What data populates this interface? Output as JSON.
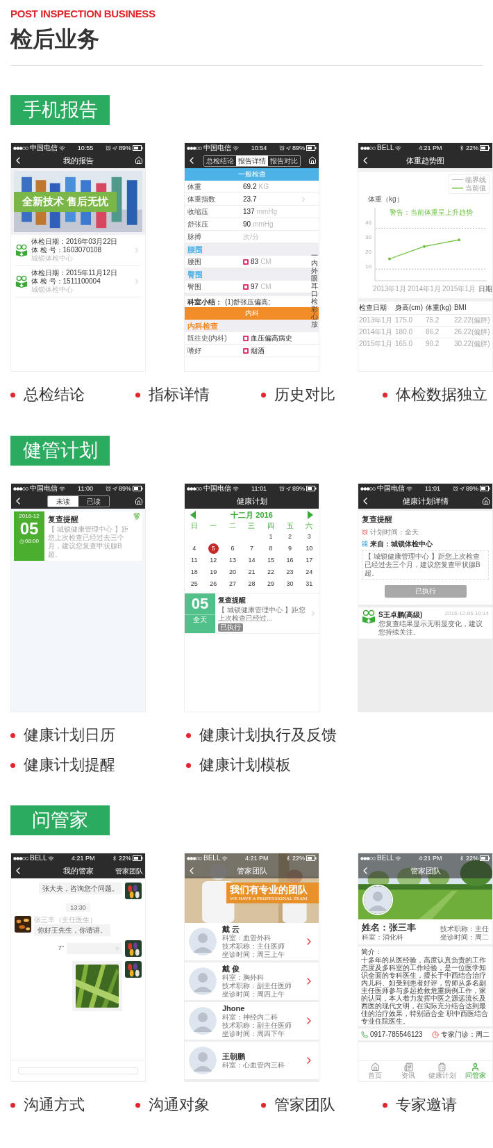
{
  "page_header": {
    "english_title": "POST INSPECTION BUSINESS",
    "title": "检后业务"
  },
  "sections": [
    {
      "tag": "手机报告",
      "screens": [
        {
          "kind": "report_list",
          "status": {
            "carrier": "中国电信",
            "time": "10:55",
            "battery": "89%",
            "bluetooth": false
          },
          "nav": {
            "title": "我的报告",
            "back": true,
            "home": true
          },
          "banner_caption": "全新技术 售后无忧",
          "reports": [
            {
              "date": "体检日期：2016年03月22日",
              "number": "体 检 号：1603070108",
              "center": "城锁体检中心"
            },
            {
              "date": "体检日期：2015年11月12日",
              "number": "体 检 号：1511100004",
              "center": "城锁体检中心"
            }
          ]
        },
        {
          "kind": "report_detail",
          "status": {
            "carrier": "中国电信",
            "time": "10:54",
            "battery": "89%",
            "bluetooth": false
          },
          "nav": {
            "back": true,
            "home": true,
            "tabs": [
              {
                "label": "总检结论",
                "selected": false
              },
              {
                "label": "报告详情",
                "selected": true
              },
              {
                "label": "报告对比",
                "selected": false
              }
            ]
          },
          "items": [
            {
              "kind": "band",
              "text": "一般检查",
              "color": "#4db3e6"
            },
            {
              "kind": "row",
              "label": "体重",
              "value": "69.2",
              "unit": "KG",
              "flagged": false,
              "more": false
            },
            {
              "kind": "row",
              "label": "体重指数",
              "value": "23.7",
              "flagged": false,
              "more": true
            },
            {
              "kind": "row",
              "label": "收缩压",
              "value": "137",
              "unit": "mmHg",
              "flagged": false,
              "more": false
            },
            {
              "kind": "row",
              "label": "舒张压",
              "value": "90",
              "unit": "mmHg",
              "flagged": false,
              "more": false
            },
            {
              "kind": "row",
              "label": "脉搏",
              "unit": "次/分",
              "flagged": false,
              "more": false
            },
            {
              "kind": "group",
              "text": "腰围",
              "color": "#4db3e6"
            },
            {
              "kind": "row",
              "label": "腰围",
              "value": "83",
              "unit": "CM",
              "flagged": true,
              "more": false
            },
            {
              "kind": "group",
              "text": "臀围",
              "color": "#4db3e6"
            },
            {
              "kind": "row",
              "label": "臀围",
              "value": "97",
              "unit": "CM",
              "flagged": true,
              "more": false
            },
            {
              "kind": "summary",
              "label": "科室小结：",
              "text": "(1)舒张压偏高;"
            },
            {
              "kind": "band",
              "text": "内科",
              "color": "#f28c28"
            },
            {
              "kind": "group",
              "text": "内科检查",
              "color": "#f28c28"
            },
            {
              "kind": "row",
              "label": "既往史(内科)",
              "value": "血压偏高病史",
              "flagged": true,
              "more": false
            },
            {
              "kind": "row",
              "label": "嗜好",
              "value": "烟酒",
              "flagged": true,
              "more": false
            }
          ],
          "side_index": "一内外眼耳口检彩心放"
        },
        {
          "kind": "weight_chart",
          "status": {
            "carrier": "BELL",
            "time": "4:21 PM",
            "battery": "22%",
            "bluetooth": true
          },
          "nav": {
            "title": "体重趋势图",
            "back": true,
            "home": false
          },
          "chart_data": {
            "type": "line",
            "ylabel": "体重（kg）",
            "xlabel": "日期",
            "categories": [
              "2013年1月",
              "2014年1月",
              "2015年1月"
            ],
            "series": [
              {
                "name": "当前值",
                "color": "#6cbf3b",
                "values": [
                  15,
                  23.5,
                  28
                ]
              }
            ],
            "ylim": [
              0,
              50
            ],
            "yticks": [
              10,
              20,
              30,
              40
            ],
            "ref_lines": [
              {
                "axis": "y",
                "value": 36,
                "label": "临界线"
              },
              {
                "axis": "y",
                "value": 8
              }
            ],
            "legend": "upper right",
            "annotations": [
              {
                "text": "警告：当前体重呈上升趋势"
              }
            ]
          },
          "table": {
            "columns": [
              "检查日期",
              "身高(cm)",
              "体重(kg)",
              "BMI"
            ],
            "rows": [
              [
                "2013年1月",
                "175.0",
                "75.2",
                "22.22(偏胖)"
              ],
              [
                "2014年1月",
                "180.0",
                "86.2",
                "26.22(偏胖)"
              ],
              [
                "2015年1月",
                "165.0",
                "90.2",
                "30.22(偏胖)"
              ]
            ]
          }
        }
      ],
      "bullet_rows": [
        [
          "总检结论",
          "指标详情",
          "历史对比",
          "体检数据独立"
        ]
      ]
    },
    {
      "tag": "健管计划",
      "screens": [
        {
          "kind": "reminder_list",
          "status": {
            "carrier": "中国电信",
            "time": "11:00",
            "battery": "89%",
            "bluetooth": false
          },
          "nav": {
            "back": true,
            "home": true,
            "tabs": [
              {
                "label": "未读",
                "selected": true
              },
              {
                "label": "已读",
                "selected": false
              }
            ]
          },
          "reminders": [
            {
              "month": "2016-12",
              "day": "05",
              "time": "08:00",
              "title": "复查提醒",
              "text": "【 城锁健康管理中心 】距您上次检查已经过去三个月，建议您复查甲状腺B超。"
            }
          ]
        },
        {
          "kind": "calendar",
          "status": {
            "carrier": "中国电信",
            "time": "11:01",
            "battery": "89%",
            "bluetooth": false
          },
          "nav": {
            "title": "健康计划",
            "back": false,
            "home": false
          },
          "month": "十二月 2016",
          "weekdays": [
            "日",
            "一",
            "二",
            "三",
            "四",
            "五",
            "六"
          ],
          "weeks": [
            [
              {
                "day": "1",
                "selected": false
              },
              {
                "day": "2",
                "selected": false
              },
              {
                "day": "3",
                "selected": false
              }
            ],
            [
              {
                "day": "4",
                "selected": false
              },
              {
                "day": "5",
                "selected": true
              },
              {
                "day": "6",
                "selected": false
              },
              {
                "day": "7",
                "selected": false
              },
              {
                "day": "8",
                "selected": false
              },
              {
                "day": "9",
                "selected": false
              },
              {
                "day": "10",
                "selected": false
              }
            ],
            [
              {
                "day": "11",
                "selected": false
              },
              {
                "day": "12",
                "selected": false
              },
              {
                "day": "13",
                "selected": false
              },
              {
                "day": "14",
                "selected": false
              },
              {
                "day": "15",
                "selected": false
              },
              {
                "day": "16",
                "selected": false
              },
              {
                "day": "17",
                "selected": false
              }
            ],
            [
              {
                "day": "18",
                "selected": false
              },
              {
                "day": "19",
                "selected": false
              },
              {
                "day": "20",
                "selected": false
              },
              {
                "day": "21",
                "selected": false
              },
              {
                "day": "22",
                "selected": false
              },
              {
                "day": "23",
                "selected": false
              },
              {
                "day": "24",
                "selected": false
              }
            ],
            [
              {
                "day": "25",
                "selected": false
              },
              {
                "day": "26",
                "selected": false
              },
              {
                "day": "27",
                "selected": false
              },
              {
                "day": "28",
                "selected": false
              },
              {
                "day": "29",
                "selected": false
              },
              {
                "day": "30",
                "selected": false
              },
              {
                "day": "31",
                "selected": false
              }
            ]
          ],
          "event": {
            "day": "05",
            "time": "全天",
            "title": "复查提醒",
            "text": "【 城锁健康管理中心 】距您上次检查已经过...",
            "status": "已执行"
          }
        },
        {
          "kind": "plan_detail",
          "status": {
            "carrier": "中国电信",
            "time": "11:01",
            "battery": "89%",
            "bluetooth": false
          },
          "nav": {
            "title": "健康计划详情",
            "back": true,
            "home": true
          },
          "title": "复查提醒",
          "plan_time": "计划时间：全天",
          "source": "来自：城锁体检中心",
          "message": "【 城锁健康管理中心 】距您上次检查已经过去三个月，建议您复查甲状腺B超。",
          "button": {
            "label": "已执行",
            "disabled": true
          },
          "comment": {
            "name": "S王卓鹏(高级)",
            "time": "2016-12-06 10:14",
            "text": "您复查结果显示无明显变化，建议您持续关注。"
          }
        }
      ],
      "bullet_rows": [
        [
          "健康计划日历",
          "健康计划执行及反馈"
        ],
        [
          "健康计划提醒",
          "健康计划模板"
        ]
      ]
    },
    {
      "tag": "问管家",
      "screens": [
        {
          "kind": "chat",
          "status": {
            "carrier": "BELL",
            "time": "4:21 PM",
            "battery": "22%",
            "bluetooth": true
          },
          "nav": {
            "title": "我的管家",
            "back": true,
            "home": false,
            "action": "管家团队"
          },
          "messages": [
            {
              "kind": "sent_text",
              "text": "张大夫，咨询您个问题。"
            },
            {
              "kind": "time",
              "text": "13:30"
            },
            {
              "kind": "received_text",
              "sender": "张三丰（主任医生）",
              "text": "你好王先生，你请讲。"
            },
            {
              "kind": "sent_voice",
              "duration": "7\""
            },
            {
              "kind": "sent_image"
            }
          ]
        },
        {
          "kind": "team_list",
          "status": {
            "carrier": "BELL",
            "time": "4:21 PM",
            "battery": "22%",
            "bluetooth": true
          },
          "nav": {
            "title": "管家团队",
            "back": true,
            "home": false
          },
          "banner_title": "我们有专业的团队",
          "banner_subtitle": "WE HAVE A PROFESSIONAL TEAM",
          "doctors": [
            {
              "name": "戴 云",
              "department": "科室：血管外科",
              "rank": "技术职称：主任医师",
              "hours": "坐诊时间：周三上午"
            },
            {
              "name": "戴 俊",
              "department": "科室：胸外科",
              "rank": "技术职称：副主任医师",
              "hours": "坐诊时间：周四上午"
            },
            {
              "name": "Jhone",
              "department": "科室：神经内二科",
              "rank": "技术职称：副主任医师",
              "hours": "坐诊时间：周四下午"
            },
            {
              "name": "王朝鹏",
              "department": "科室：心血管内三科"
            }
          ]
        },
        {
          "kind": "doctor_profile",
          "status": {
            "carrier": "BELL",
            "time": "4:21 PM",
            "battery": "22%",
            "bluetooth": true
          },
          "nav": {
            "title": "管家团队",
            "back": true,
            "home": false
          },
          "name": "姓名：张三丰",
          "department": "科室：消化科",
          "rank": "技术职称：主任",
          "hours": "坐诊时间：周二",
          "intro_title": "简介：",
          "intro": "十多年的从医经验，高度认真负责的工作态度及多科室的工作经验，是一位医学知识全面的专科医生，擅长于中西结合治疗内儿科、妇受到患者好评，曾师从多名副主任医师参与多起抢救危重病例工作，家的认同，本人着力发挥中医之源远流长及西医的现代文明，在实际充分结合达到最佳的治疗效果，特别适合全 职中西医结合专业住院医生。",
          "phone": "0917-785546123",
          "clinic": "专家门诊：周二",
          "tabs": [
            {
              "kind": "home",
              "label": "首页",
              "selected": false
            },
            {
              "kind": "news",
              "label": "资讯",
              "selected": false
            },
            {
              "kind": "plan",
              "label": "健康计划",
              "selected": false
            },
            {
              "kind": "steward",
              "label": "问管家",
              "selected": true
            }
          ]
        }
      ],
      "bullet_rows": [
        [
          "沟通方式",
          "沟通对象",
          "管家团队",
          "专家邀请"
        ]
      ]
    }
  ]
}
